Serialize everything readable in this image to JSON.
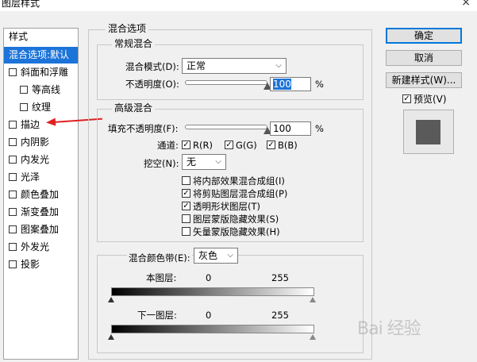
{
  "window": {
    "title": "图层样式",
    "close_icon": "×"
  },
  "style_list": {
    "header": "样式",
    "items": [
      {
        "label": "混合选项:默认",
        "selected": true,
        "checkbox": false
      },
      {
        "label": "斜面和浮雕",
        "checkbox": true
      },
      {
        "label": "等高线",
        "checkbox": true,
        "indent": true
      },
      {
        "label": "纹理",
        "checkbox": true,
        "indent": true
      },
      {
        "label": "描边",
        "checkbox": true
      },
      {
        "label": "内阴影",
        "checkbox": true
      },
      {
        "label": "内发光",
        "checkbox": true
      },
      {
        "label": "光泽",
        "checkbox": true
      },
      {
        "label": "颜色叠加",
        "checkbox": true
      },
      {
        "label": "渐变叠加",
        "checkbox": true
      },
      {
        "label": "图案叠加",
        "checkbox": true
      },
      {
        "label": "外发光",
        "checkbox": true
      },
      {
        "label": "投影",
        "checkbox": true
      }
    ]
  },
  "blend_options": {
    "title": "混合选项",
    "general": {
      "title": "常规混合",
      "blend_mode_label": "混合模式(D):",
      "blend_mode_value": "正常",
      "opacity_label": "不透明度(O):",
      "opacity_value": "100",
      "opacity_unit": "%",
      "opacity_level": 100
    },
    "advanced": {
      "title": "高级混合",
      "fill_opacity_label": "填充不透明度(F):",
      "fill_opacity_value": "100",
      "fill_opacity_unit": "%",
      "fill_level": 100,
      "channels_label": "通道:",
      "channel_r": "R(R)",
      "channel_g": "G(G)",
      "channel_b": "B(B)",
      "knockout_label": "挖空(N):",
      "knockout_value": "无",
      "opt1": "将内部效果混合成组(I)",
      "opt2": "将剪贴图层混合成组(P)",
      "opt3": "透明形状图层(T)",
      "opt4": "图层蒙版隐藏效果(S)",
      "opt5": "矢量蒙版隐藏效果(H)",
      "check_mark": "✓"
    },
    "blend_if": {
      "label": "混合颜色带(E):",
      "value": "灰色",
      "this_layer": "本图层:",
      "this_min": "0",
      "this_max": "255",
      "under_layer": "下一图层:",
      "under_min": "0",
      "under_max": "255"
    }
  },
  "buttons": {
    "ok": "确定",
    "cancel": "取消",
    "new_style": "新建样式(W)...",
    "preview_label": "预览(V)"
  },
  "watermark": "Bai 经验",
  "icons": {
    "chevron": "⌵"
  }
}
